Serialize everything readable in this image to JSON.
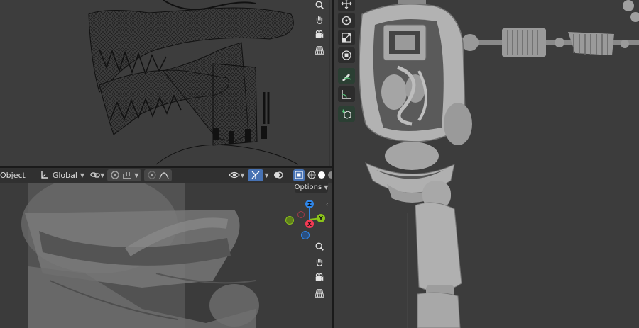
{
  "header": {
    "mode_label": "Object",
    "orientation": "Global",
    "options_label": "Options"
  },
  "gizmo": {
    "x": "X",
    "y": "Y",
    "z": "Z"
  },
  "icons": {
    "navigation": [
      "zoom-icon",
      "pan-hand-icon",
      "camera-icon",
      "grid-perspective-icon"
    ],
    "tools": [
      "move-icon",
      "rotate-icon",
      "scale-icon",
      "transform-icon",
      "annotate-icon",
      "measure-icon",
      "add-cube-icon"
    ]
  },
  "colors": {
    "axis_x": "#f23a54",
    "axis_y": "#8bc31a",
    "axis_z": "#2f86e9",
    "active_tool": "#2b3f33",
    "header_active": "#4772b3"
  }
}
